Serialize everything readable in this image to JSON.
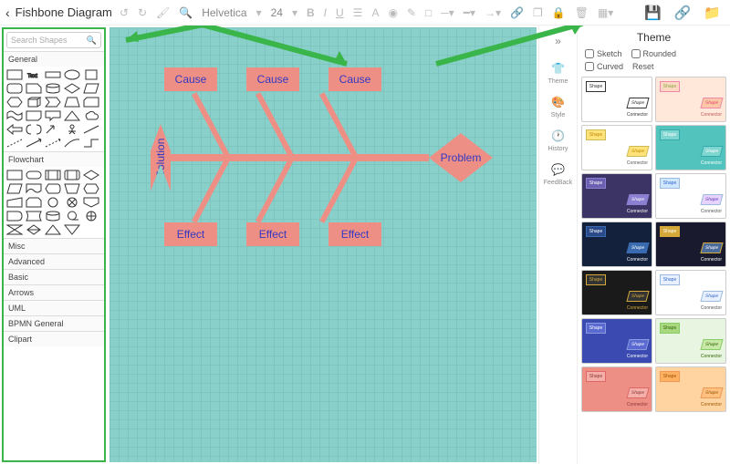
{
  "title": "Fishbone Diagram",
  "toolbar": {
    "font": "Helvetica",
    "size": "24"
  },
  "search": {
    "placeholder": "Search Shapes"
  },
  "shapeCats": {
    "general": "General",
    "flowchart": "Flowchart",
    "misc": "Misc",
    "advanced": "Advanced",
    "basic": "Basic",
    "arrows": "Arrows",
    "uml": "UML",
    "bpmn": "BPMN General",
    "clipart": "Clipart"
  },
  "diagram": {
    "solution": "Solution",
    "problem": "Problem",
    "cause": "Cause",
    "effect": "Effect"
  },
  "sidebar": {
    "theme": "Theme",
    "style": "Style",
    "history": "History",
    "feedback": "FeedBack"
  },
  "panel": {
    "title": "Theme",
    "sketch": "Sketch",
    "rounded": "Rounded",
    "curved": "Curved",
    "reset": "Reset",
    "shape": "Shape",
    "connector": "Connector"
  },
  "themes": [
    {
      "bg": "#fff",
      "s1b": "#fff",
      "s1c": "#333",
      "s2b": "#fff",
      "s2c": "#333",
      "tc": "#333",
      "bd": "#333"
    },
    {
      "bg": "#ffe8d9",
      "s1b": "#fdd8c2",
      "s1c": "#8a4",
      "s2b": "#fcc8a8",
      "s2c": "#d46",
      "tc": "#b55",
      "bd": "#e8a"
    },
    {
      "bg": "#fff",
      "s1b": "#ffe37a",
      "s1c": "#b80",
      "s2b": "#ffe37a",
      "s2c": "#b80",
      "tc": "#555",
      "bd": "#cb5"
    },
    {
      "bg": "#52c4bd",
      "s1b": "#7fd6d0",
      "s1c": "#fff",
      "s2b": "#7fd6d0",
      "s2c": "#fff",
      "tc": "#fff",
      "bd": "#3aa"
    },
    {
      "bg": "#3b3464",
      "s1b": "#6a5fb0",
      "s1c": "#fff",
      "s2b": "#8a7fd0",
      "s2c": "#fff",
      "tc": "#fff",
      "bd": "#8a7fd0"
    },
    {
      "bg": "#fff",
      "s1b": "#cfe6ff",
      "s1c": "#36c",
      "s2b": "#e6d4ff",
      "s2c": "#63a",
      "tc": "#555",
      "bd": "#9bd"
    },
    {
      "bg": "#14213d",
      "s1b": "#2a4a8a",
      "s1c": "#fff",
      "s2b": "#3a6ab0",
      "s2c": "#fff",
      "tc": "#fff",
      "bd": "#3a6ab0"
    },
    {
      "bg": "#1a1a2e",
      "s1b": "#d4a93a",
      "s1c": "#fff",
      "s2b": "#4a6a9a",
      "s2c": "#fff",
      "tc": "#fff",
      "bd": "#d4a93a"
    },
    {
      "bg": "#1a1a1a",
      "s1b": "#333",
      "s1c": "#d4a93a",
      "s2b": "#333",
      "s2c": "#d4a93a",
      "tc": "#d4a93a",
      "bd": "#d4a93a"
    },
    {
      "bg": "#fff",
      "s1b": "#e8f0ff",
      "s1c": "#36c",
      "s2b": "#e8f0ff",
      "s2c": "#36c",
      "tc": "#555",
      "bd": "#9bd"
    },
    {
      "bg": "#3a4ab0",
      "s1b": "#5a6ad0",
      "s1c": "#fff",
      "s2b": "#5a6ad0",
      "s2c": "#fff",
      "tc": "#fff",
      "bd": "#8a9ae0"
    },
    {
      "bg": "#e8f5e0",
      "s1b": "#a8d880",
      "s1c": "#360",
      "s2b": "#c8e8a8",
      "s2c": "#360",
      "tc": "#360",
      "bd": "#8c6"
    },
    {
      "bg": "#ee8f85",
      "s1b": "#f4b0a8",
      "s1c": "#833",
      "s2b": "#f4b0a8",
      "s2c": "#833",
      "tc": "#833",
      "bd": "#d66"
    },
    {
      "bg": "#ffd4a0",
      "s1b": "#ffb060",
      "s1c": "#950",
      "s2b": "#ffc080",
      "s2c": "#950",
      "tc": "#950",
      "bd": "#e95"
    }
  ]
}
